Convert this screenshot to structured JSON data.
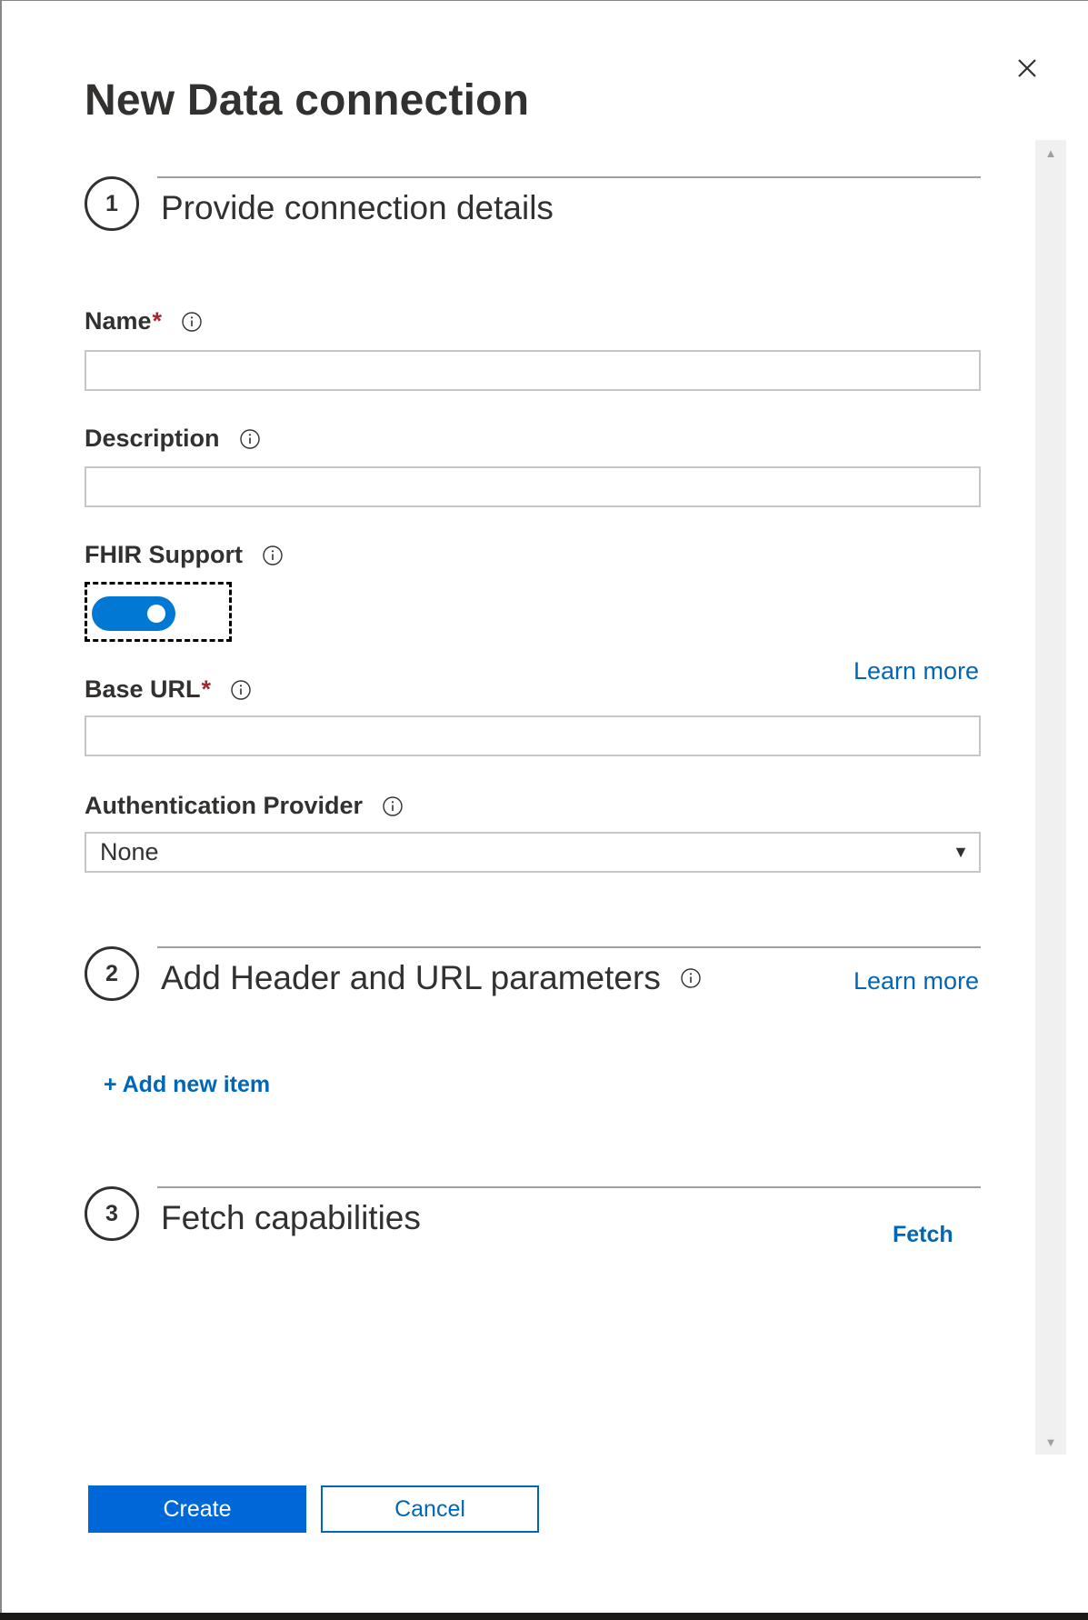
{
  "dialog": {
    "title": "New Data connection",
    "close_icon": "close-icon"
  },
  "steps": [
    {
      "number": "1",
      "title": "Provide connection details"
    },
    {
      "number": "2",
      "title": "Add Header and URL parameters"
    },
    {
      "number": "3",
      "title": "Fetch capabilities"
    }
  ],
  "fields": {
    "name": {
      "label": "Name",
      "required_mark": "*",
      "value": ""
    },
    "description": {
      "label": "Description",
      "value": ""
    },
    "fhir_support": {
      "label": "FHIR Support",
      "checked": true
    },
    "base_url": {
      "label": "Base URL",
      "required_mark": "*",
      "value": ""
    },
    "auth_provider": {
      "label": "Authentication Provider",
      "value": "None",
      "arrow": "▼"
    }
  },
  "links": {
    "learn_more_1": "Learn more",
    "learn_more_2": "Learn more",
    "add_new_item": "+ Add new item",
    "fetch": "Fetch"
  },
  "footer": {
    "create_label": "Create",
    "cancel_label": "Cancel"
  },
  "scrollbar": {
    "up_arrow": "▲",
    "down_arrow": "▼"
  },
  "colors": {
    "accent": "#0078d4",
    "link": "#0067b8",
    "primary_button": "#0067d8",
    "required": "#a4262c",
    "text": "#323130"
  }
}
